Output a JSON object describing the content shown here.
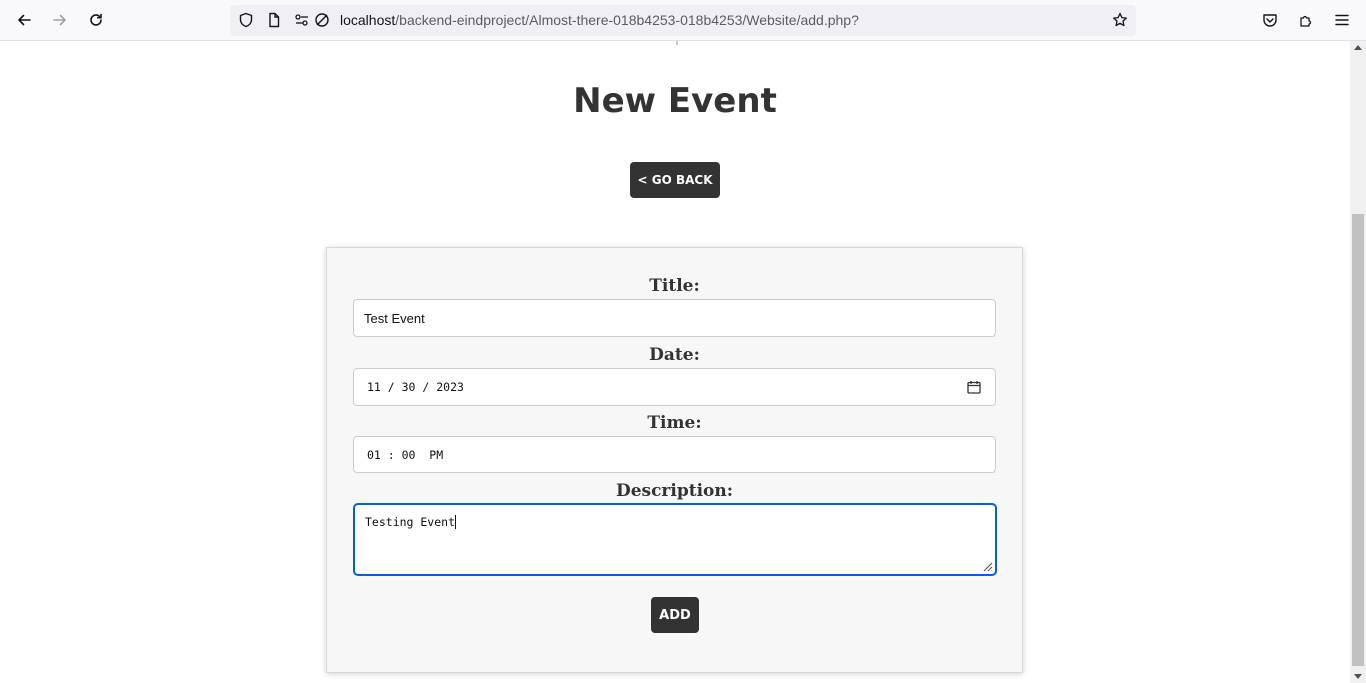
{
  "browser": {
    "url_host": "localhost",
    "url_path": "/backend-eindproject/Almost-there-018b4253-018b4253/Website/add.php?",
    "icons": [
      "back-icon",
      "forward-icon",
      "reload-icon",
      "shield-icon",
      "page-icon",
      "permissions-icon",
      "tracking-protection-off-icon",
      "bookmark-star-icon",
      "pocket-icon",
      "extensions-icon",
      "menu-icon"
    ]
  },
  "page": {
    "title": "New Event",
    "go_back_label": "< GO BACK"
  },
  "form": {
    "title_label": "Title:",
    "title_value": "Test Event",
    "date_label": "Date:",
    "date_value": "11 / 30 / 2023",
    "time_label": "Time:",
    "time_value": "01 : 00  PM",
    "description_label": "Description:",
    "description_value": "Testing Event",
    "submit_label": "ADD"
  },
  "colors": {
    "accent": "#333333",
    "focus": "#0060df",
    "card_bg": "#f7f7f7"
  }
}
